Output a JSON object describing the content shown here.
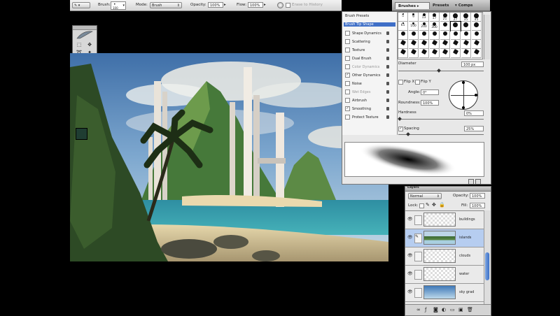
{
  "options_bar": {
    "brush_label": "Brush:",
    "brush_size": "100",
    "mode_label": "Mode:",
    "mode_value": "Brush",
    "opacity_label": "Opacity:",
    "opacity_value": "100%",
    "flow_label": "Flow:",
    "flow_value": "100%",
    "erase_history_label": "Erase to History"
  },
  "palette_well": {
    "tabs": [
      "Brushes",
      "Presets",
      "Comps"
    ]
  },
  "brushes_panel": {
    "categories": [
      {
        "label": "Brush Presets",
        "checkbox": false,
        "checked": false,
        "selected": false,
        "lock": false,
        "dim": false
      },
      {
        "label": "Brush Tip Shape",
        "checkbox": false,
        "checked": false,
        "selected": true,
        "lock": false,
        "dim": false
      },
      {
        "label": "Shape Dynamics",
        "checkbox": true,
        "checked": false,
        "selected": false,
        "lock": true,
        "dim": false
      },
      {
        "label": "Scattering",
        "checkbox": true,
        "checked": false,
        "selected": false,
        "lock": true,
        "dim": false
      },
      {
        "label": "Texture",
        "checkbox": true,
        "checked": false,
        "selected": false,
        "lock": true,
        "dim": false
      },
      {
        "label": "Dual Brush",
        "checkbox": true,
        "checked": false,
        "selected": false,
        "lock": true,
        "dim": false
      },
      {
        "label": "Color Dynamics",
        "checkbox": true,
        "checked": false,
        "selected": false,
        "lock": true,
        "dim": true
      },
      {
        "label": "Other Dynamics",
        "checkbox": true,
        "checked": true,
        "selected": false,
        "lock": true,
        "dim": false
      },
      {
        "label": "Noise",
        "checkbox": true,
        "checked": false,
        "selected": false,
        "lock": true,
        "dim": false
      },
      {
        "label": "Wet Edges",
        "checkbox": true,
        "checked": false,
        "selected": false,
        "lock": true,
        "dim": true
      },
      {
        "label": "Airbrush",
        "checkbox": true,
        "checked": false,
        "selected": false,
        "lock": true,
        "dim": false
      },
      {
        "label": "Smoothing",
        "checkbox": true,
        "checked": true,
        "selected": false,
        "lock": true,
        "dim": false
      },
      {
        "label": "Protect Texture",
        "checkbox": true,
        "checked": false,
        "selected": false,
        "lock": true,
        "dim": false
      }
    ],
    "tip_sizes": [
      "5",
      "9",
      "13",
      "17",
      "21",
      "27",
      "35",
      "45",
      "65",
      "100",
      "200",
      "300"
    ],
    "diameter_label": "Diameter",
    "diameter_value": "100 px",
    "flipx_label": "Flip X",
    "flipy_label": "Flip Y",
    "angle_label": "Angle:",
    "angle_value": "0°",
    "roundness_label": "Roundness:",
    "roundness_value": "100%",
    "hardness_label": "Hardness",
    "hardness_value": "0%",
    "spacing_label": "Spacing",
    "spacing_value": "25%"
  },
  "layers_panel": {
    "tab_label": "Layers",
    "blend_mode": "Normal",
    "opacity_label": "Opacity:",
    "opacity_value": "100%",
    "lock_label": "Lock:",
    "fill_label": "Fill:",
    "fill_value": "100%",
    "layers": [
      {
        "name": "buildings",
        "selected": false,
        "thumb": "buildings"
      },
      {
        "name": "islands",
        "selected": true,
        "thumb": "islands"
      },
      {
        "name": "clouds",
        "selected": false,
        "thumb": "clouds"
      },
      {
        "name": "water",
        "selected": false,
        "thumb": "water"
      },
      {
        "name": "sky grad",
        "selected": false,
        "thumb": "sky"
      }
    ]
  },
  "colors": {
    "foreground": "#1f3d32",
    "background": "#ffffff",
    "selection": "#b6cdf0"
  }
}
